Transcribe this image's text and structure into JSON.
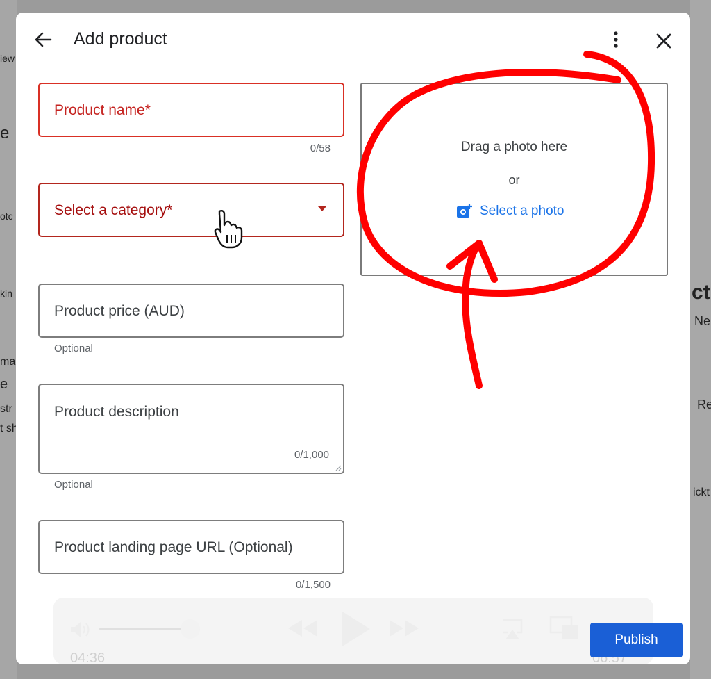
{
  "background": {
    "fragments": [
      "iew",
      "e",
      "otc",
      "kin",
      "ma",
      "e",
      "str",
      "t sh",
      "cti",
      "Ne",
      "Re",
      "ickt"
    ]
  },
  "dialog": {
    "title": "Add product",
    "back_icon": "arrow-left-icon",
    "more_icon": "more-vert-icon",
    "close_icon": "close-icon"
  },
  "form": {
    "product_name": {
      "placeholder": "Product name*",
      "counter": "0/58"
    },
    "category": {
      "placeholder": "Select a category*"
    },
    "price": {
      "placeholder": "Product price (AUD)",
      "helper": "Optional"
    },
    "description": {
      "placeholder": "Product description",
      "counter": "0/1,000",
      "helper": "Optional"
    },
    "landing_url": {
      "placeholder": "Product landing page URL (Optional)",
      "counter": "0/1,500"
    }
  },
  "photo": {
    "drag_text": "Drag a photo here",
    "or_text": "or",
    "select_label": "Select a photo",
    "select_icon": "add-photo-icon"
  },
  "player": {
    "elapsed": "04:36",
    "remaining": "06:57",
    "volume_level": 0.9
  },
  "publish_label": "Publish",
  "colors": {
    "error": "#d93025",
    "link": "#1a73e8",
    "primary_button": "#1a5fd6",
    "annotation": "#ff0000"
  }
}
